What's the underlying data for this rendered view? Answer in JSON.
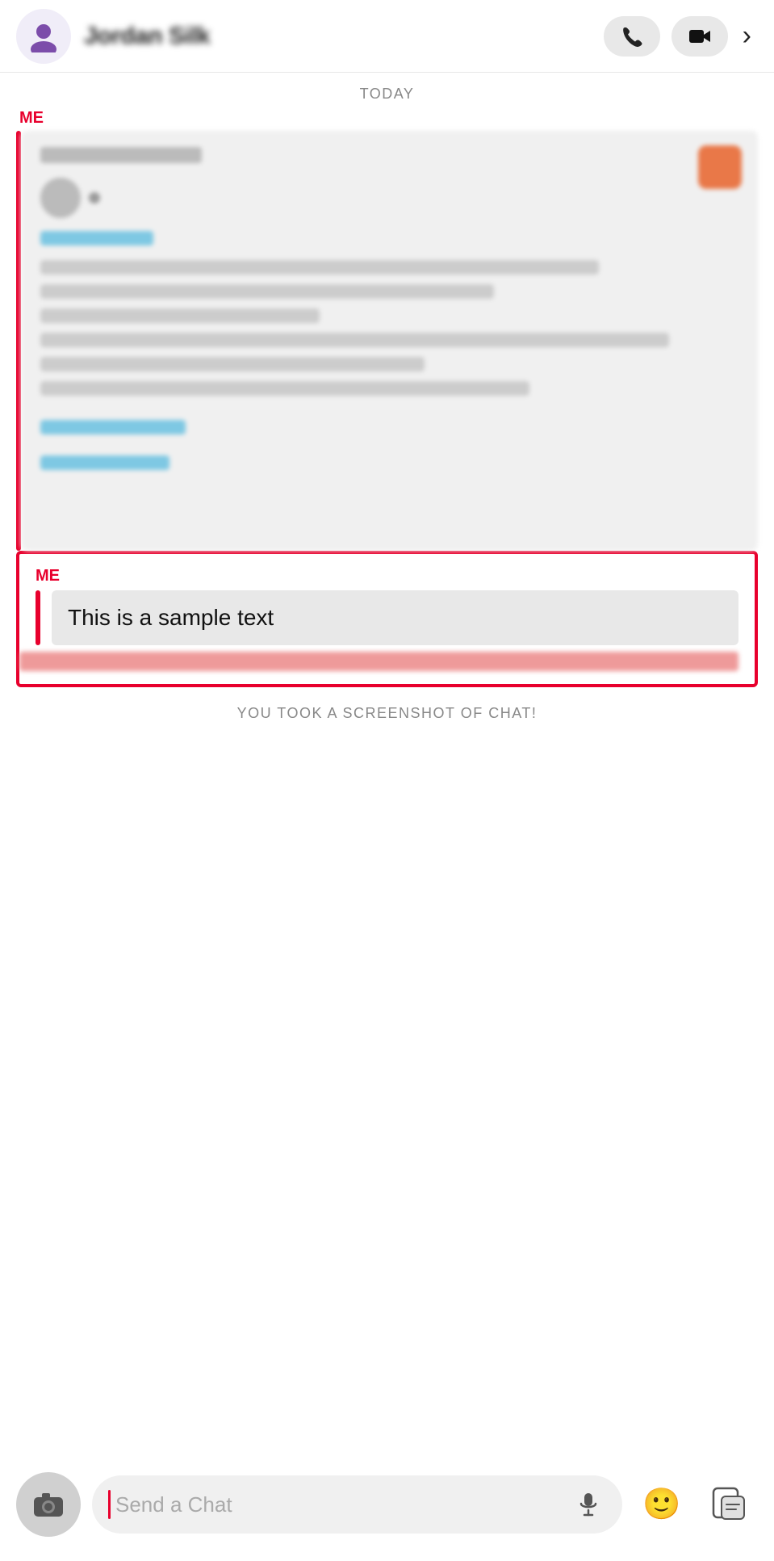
{
  "header": {
    "name": "Jordan Silk",
    "phone_btn_label": "phone",
    "video_btn_label": "video",
    "more_btn_label": "more"
  },
  "chat": {
    "date_separator": "TODAY",
    "sender_label_1": "ME",
    "sender_label_2": "ME",
    "highlighted_message": "This is a sample text",
    "screenshot_notice": "YOU TOOK A SCREENSHOT OF CHAT!"
  },
  "input_bar": {
    "placeholder": "Send a Chat",
    "camera_label": "camera",
    "mic_label": "microphone",
    "emoji_label": "emoji",
    "sticker_label": "sticker"
  }
}
